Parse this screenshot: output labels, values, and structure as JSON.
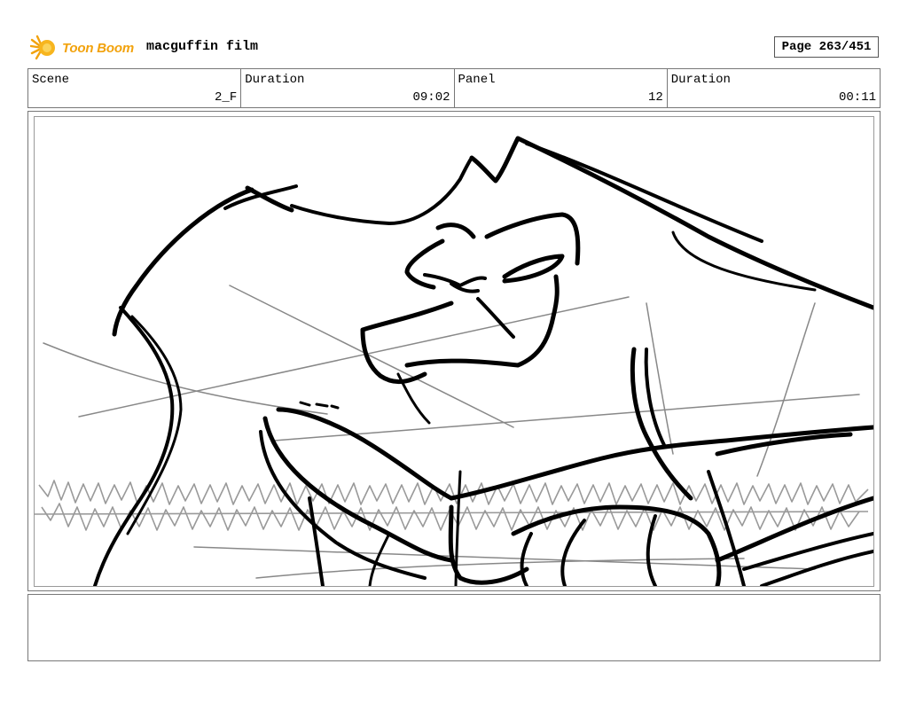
{
  "header": {
    "logo_text": "Toon Boom",
    "film_title": "macguffin film",
    "page_label": "Page 263/451"
  },
  "info": {
    "scene_label": "Scene",
    "scene_value": "2_F",
    "scene_duration_label": "Duration",
    "scene_duration_value": "09:02",
    "panel_label": "Panel",
    "panel_value": "12",
    "panel_duration_label": "Duration",
    "panel_duration_value": "00:11"
  },
  "panel": {
    "image_icon": "storyboard-sketch-gorilla",
    "sketch_color": "#000000",
    "guide_color": "#888888"
  },
  "notes": {
    "text": ""
  },
  "colors": {
    "logo_accent": "#f2a20c",
    "border": "#777777"
  }
}
